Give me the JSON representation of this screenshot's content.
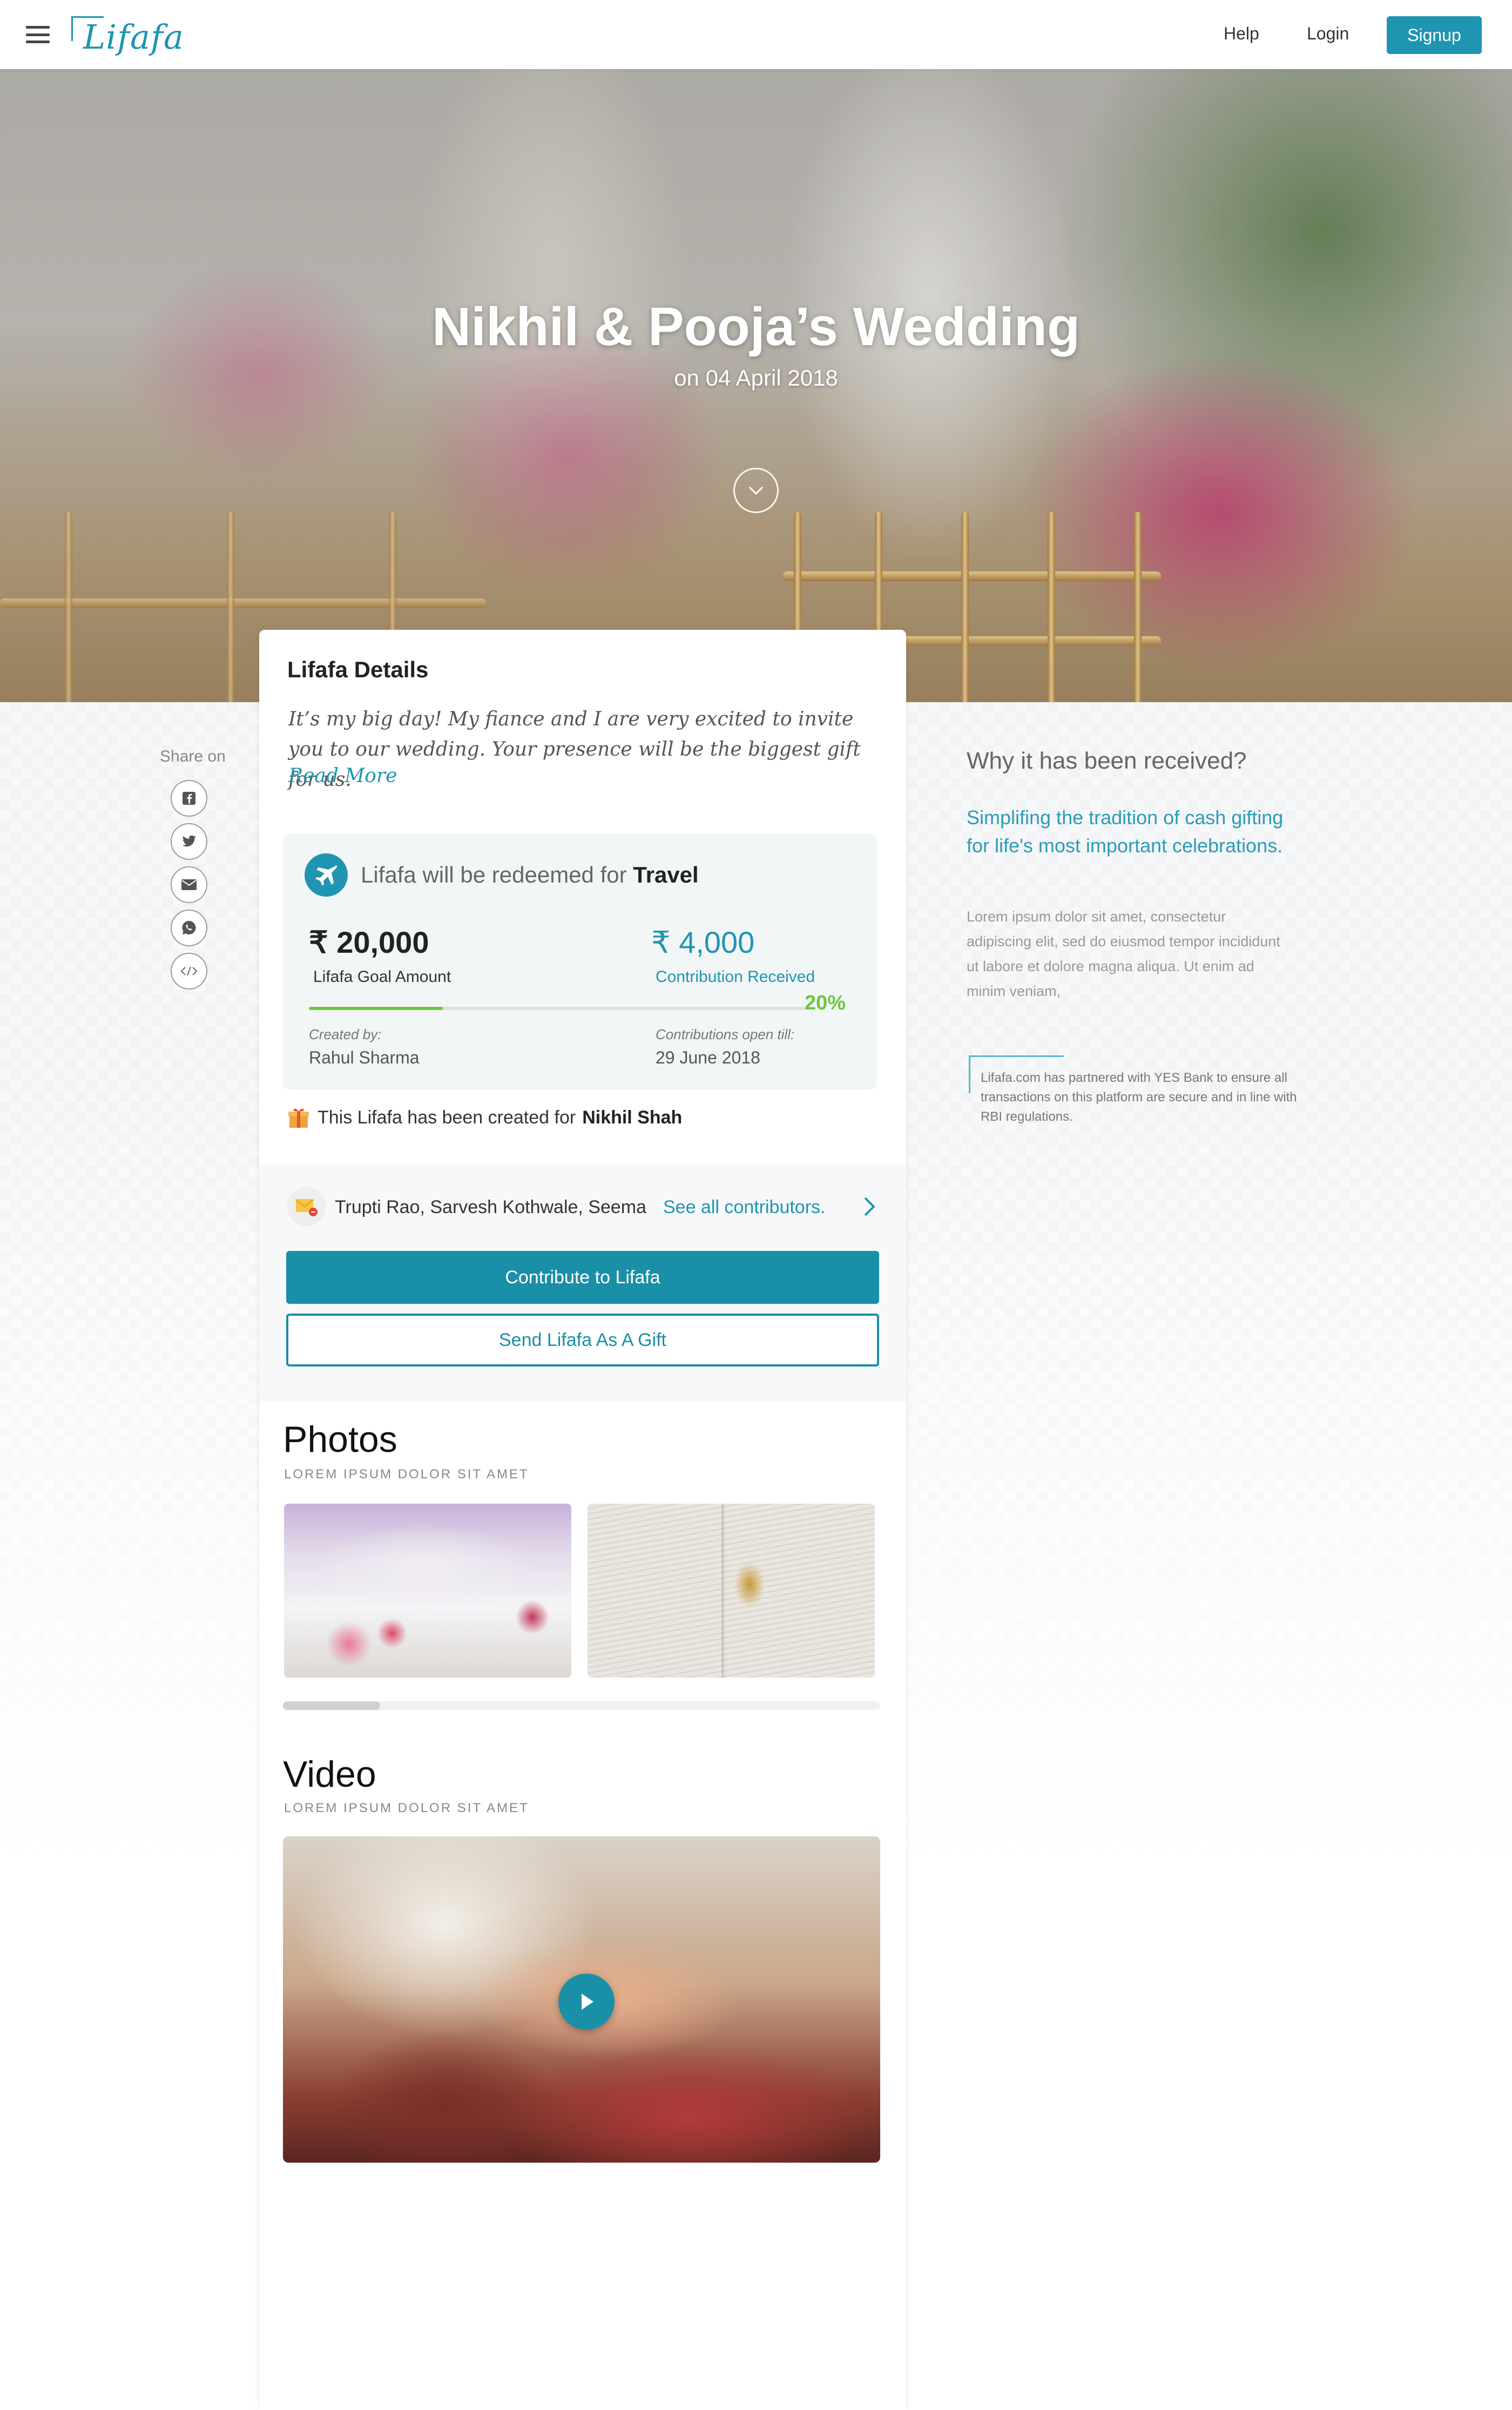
{
  "header": {
    "logo_text": "Lifafa",
    "nav": {
      "help": "Help",
      "login": "Login",
      "signup": "Signup"
    }
  },
  "hero": {
    "title": "Nikhil & Pooja’s Wedding",
    "date": "on 04 April 2018"
  },
  "share": {
    "label": "Share on",
    "icons": [
      "facebook-icon",
      "twitter-icon",
      "email-icon",
      "whatsapp-icon",
      "embed-icon"
    ]
  },
  "details": {
    "title": "Lifafa Details",
    "description": "It’s my big day! My fiance and I are very excited to invite you to our wedding. Your presence will be the biggest gift for us.",
    "read_more": "Read More",
    "redeem_prefix": "Lifafa will be redeemed for",
    "redeem_value": "Travel",
    "goal_amount": "₹ 20,000",
    "goal_label": "Lifafa Goal Amount",
    "contribution_amount": "₹ 4,000",
    "contribution_label": "Contribution Received",
    "progress_percent": 20,
    "progress_label": "20%",
    "created_by_label": "Created by:",
    "created_by": "Rahul Sharma",
    "open_till_label": "Contributions open till:",
    "open_till": "29 June 2018",
    "created_for_prefix": "This Lifafa has been created for",
    "created_for": "Nikhil Shah"
  },
  "contributors": {
    "names": "Trupti Rao, Sarvesh Kothwale, Seema",
    "see_all": "See all contributors.",
    "contribute_button": "Contribute to Lifafa",
    "gift_button": "Send Lifafa As A Gift"
  },
  "photos": {
    "title": "Photos",
    "subtitle": "LOREM IPSUM DOLOR SIT AMET"
  },
  "video": {
    "title": "Video",
    "subtitle": "LOREM IPSUM DOLOR SIT AMET"
  },
  "why": {
    "title": "Why it has been received?",
    "subtitle": "Simplifing the tradition of cash gifting for life's most important celebrations.",
    "body": "Lorem ipsum dolor sit amet, consectetur adipiscing elit, sed do eiusmod tempor incididunt ut labore et dolore magna aliqua. Ut enim ad minim veniam,",
    "partner_note": "Lifafa.com has partnered with YES Bank to ensure all transactions on this platform are secure and in line with RBI regulations."
  },
  "colors": {
    "brand": "#1f95b2",
    "progress": "#6cc83c"
  }
}
